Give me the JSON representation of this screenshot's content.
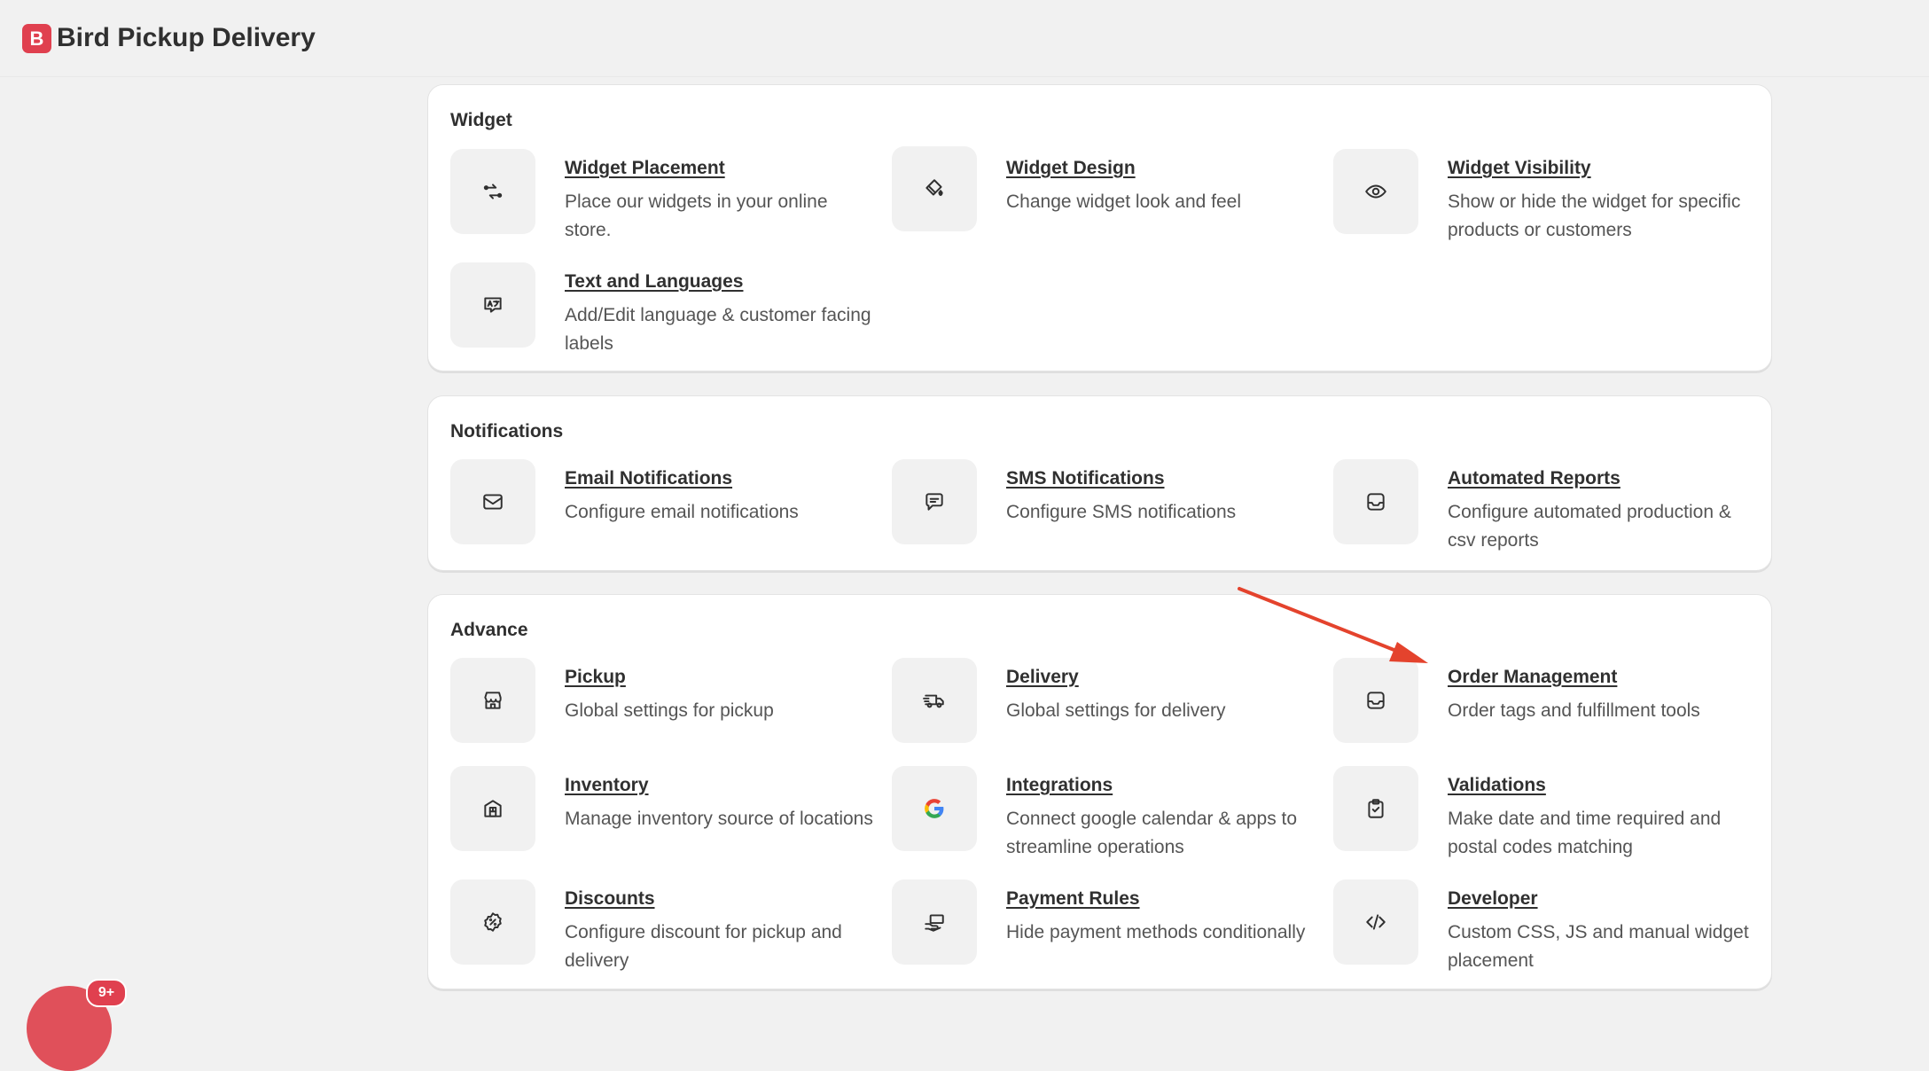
{
  "app": {
    "title": "Bird Pickup Delivery",
    "logo_letter": "B",
    "accent_color": "#e0404f"
  },
  "sections": {
    "widget": {
      "title": "Widget",
      "items": [
        {
          "icon": "arrows-swap-icon",
          "title": "Widget Placement",
          "desc": "Place our widgets in your online store."
        },
        {
          "icon": "paint-bucket-icon",
          "title": "Widget Design",
          "desc": "Change widget look and feel"
        },
        {
          "icon": "eye-icon",
          "title": "Widget Visibility",
          "desc": "Show or hide the widget for specific products or customers"
        },
        {
          "icon": "translate-icon",
          "title": "Text and Languages",
          "desc": "Add/Edit language & customer facing labels"
        }
      ]
    },
    "notifications": {
      "title": "Notifications",
      "items": [
        {
          "icon": "envelope-icon",
          "title": "Email Notifications",
          "desc": "Configure email notifications"
        },
        {
          "icon": "chat-bubble-icon",
          "title": "SMS Notifications",
          "desc": "Configure SMS notifications"
        },
        {
          "icon": "inbox-icon",
          "title": "Automated Reports",
          "desc": "Configure automated production & csv reports"
        }
      ]
    },
    "advance": {
      "title": "Advance",
      "items": [
        {
          "icon": "store-icon",
          "title": "Pickup",
          "desc": "Global settings for pickup"
        },
        {
          "icon": "delivery-truck-icon",
          "title": "Delivery",
          "desc": "Global settings for delivery"
        },
        {
          "icon": "inbox-icon",
          "title": "Order Management",
          "desc": "Order tags and fulfillment tools"
        },
        {
          "icon": "warehouse-icon",
          "title": "Inventory",
          "desc": "Manage inventory source of locations"
        },
        {
          "icon": "google-icon",
          "title": "Integrations",
          "desc": "Connect google calendar & apps to streamline operations"
        },
        {
          "icon": "clipboard-check-icon",
          "title": "Validations",
          "desc": "Make date and time required and postal codes matching"
        },
        {
          "icon": "discount-icon",
          "title": "Discounts",
          "desc": "Configure discount for pickup and delivery"
        },
        {
          "icon": "hand-cash-icon",
          "title": "Payment Rules",
          "desc": "Hide payment methods conditionally"
        },
        {
          "icon": "code-icon",
          "title": "Developer",
          "desc": "Custom CSS, JS and manual widget placement"
        }
      ]
    }
  },
  "chat": {
    "badge": "9+"
  },
  "annotation": {
    "arrow_color": "#e4432d"
  }
}
